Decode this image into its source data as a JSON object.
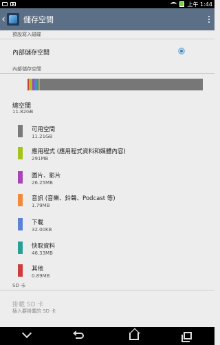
{
  "status": {
    "time": "上午 1:44"
  },
  "header": {
    "title": "儲存空間"
  },
  "default_disk": {
    "header": "預設寫入磁碟",
    "option_label": "內部儲存空間",
    "selected": true
  },
  "internal": {
    "header": "內部儲存空間",
    "total_label": "總空間",
    "total_value": "11.82GB",
    "items": [
      {
        "label": "可用空間",
        "value": "11.21GB",
        "color": "#7a7a7a"
      },
      {
        "label": "應用程式 (應用程式資料和媒體內容)",
        "value": "291MB",
        "color": "#a4c41c"
      },
      {
        "label": "圖片、影片",
        "value": "26.25MB",
        "color": "#a845b8"
      },
      {
        "label": "音訊 (音樂、鈴聲、Podcast 等)",
        "value": "1.79MB",
        "color": "#f0893a"
      },
      {
        "label": "下載",
        "value": "32.00KB",
        "color": "#5b82d6"
      },
      {
        "label": "快取資料",
        "value": "46.33MB",
        "color": "#2a9f95"
      },
      {
        "label": "其他",
        "value": "0.89MB",
        "color": "#cf3c3c"
      }
    ]
  },
  "sd": {
    "header": "SD 卡",
    "mount_title": "掛載 SD 卡",
    "mount_sub": "插入要掛載的 SD 卡"
  }
}
